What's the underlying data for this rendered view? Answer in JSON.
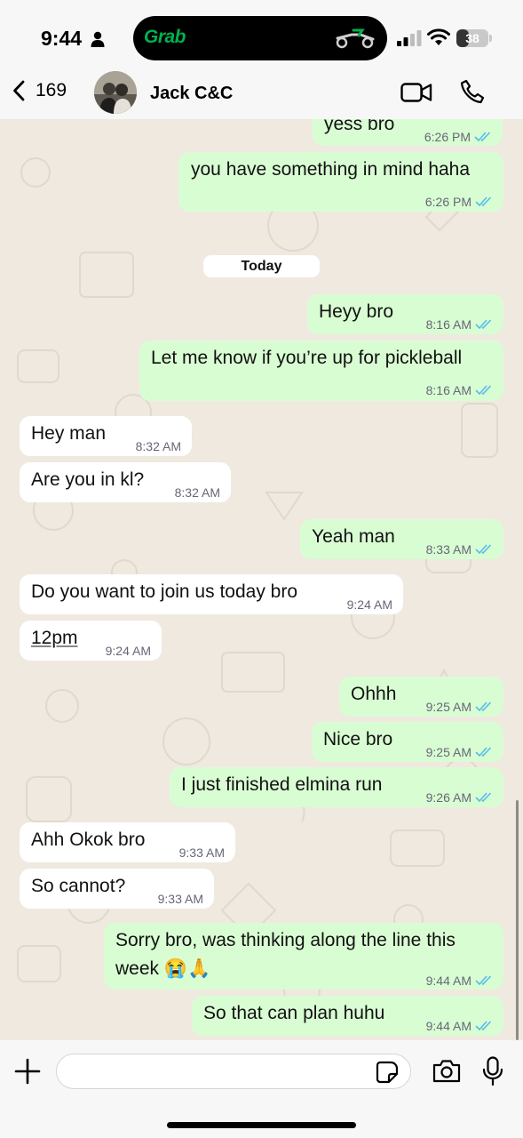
{
  "status_bar": {
    "time": "9:44",
    "island_app": "Grab",
    "battery_percent": "38",
    "battery_level": 0.38,
    "icons": [
      "person-icon",
      "scooter-icon",
      "signal-icon",
      "wifi-icon",
      "battery-icon"
    ]
  },
  "header": {
    "back_count": "169",
    "contact_name": "Jack C&C",
    "icons": [
      "back-chevron-icon",
      "avatar",
      "video-call-icon",
      "phone-call-icon"
    ]
  },
  "chat": {
    "date_separator": "Today",
    "messages": [
      {
        "direction": "outgoing",
        "text": "yess bro",
        "time": "6:26 PM",
        "read": true
      },
      {
        "direction": "outgoing",
        "text": "you have something in mind haha",
        "time": "6:26 PM",
        "read": true
      },
      {
        "direction": "outgoing",
        "text": "Heyy bro",
        "time": "8:16 AM",
        "read": true
      },
      {
        "direction": "outgoing",
        "text": "Let me know if you’re up for pickleball",
        "time": "8:16 AM",
        "read": true
      },
      {
        "direction": "incoming",
        "text": "Hey man",
        "time": "8:32 AM"
      },
      {
        "direction": "incoming",
        "text": "Are you in kl?",
        "time": "8:32 AM"
      },
      {
        "direction": "outgoing",
        "text": "Yeah man",
        "time": "8:33 AM",
        "read": true
      },
      {
        "direction": "incoming",
        "text": "Do you want to join us today bro",
        "time": "9:24 AM"
      },
      {
        "direction": "incoming",
        "text": "12pm",
        "time": "9:24 AM"
      },
      {
        "direction": "outgoing",
        "text": "Ohhh",
        "time": "9:25 AM",
        "read": true
      },
      {
        "direction": "outgoing",
        "text": "Nice bro",
        "time": "9:25 AM",
        "read": true
      },
      {
        "direction": "outgoing",
        "text": "I just finished elmina run",
        "time": "9:26 AM",
        "read": true
      },
      {
        "direction": "incoming",
        "text": "Ahh Okok bro",
        "time": "9:33 AM"
      },
      {
        "direction": "incoming",
        "text": "So cannot?",
        "time": "9:33 AM"
      },
      {
        "direction": "outgoing",
        "text": "Sorry bro, was thinking along the line this",
        "text_line2": "week 😭🙏",
        "time": "9:44 AM",
        "read": true
      },
      {
        "direction": "outgoing",
        "text": "So that can plan huhu",
        "time": "9:44 AM",
        "read": true
      }
    ]
  },
  "input_bar": {
    "value": "",
    "icons": [
      "plus-icon",
      "sticker-icon",
      "camera-icon",
      "mic-icon"
    ]
  },
  "colors": {
    "outgoing_bubble": "#d9fdd3",
    "incoming_bubble": "#ffffff",
    "chat_background": "#efe9e0",
    "read_tick": "#53bdeb",
    "grab_green": "#00b14f"
  }
}
